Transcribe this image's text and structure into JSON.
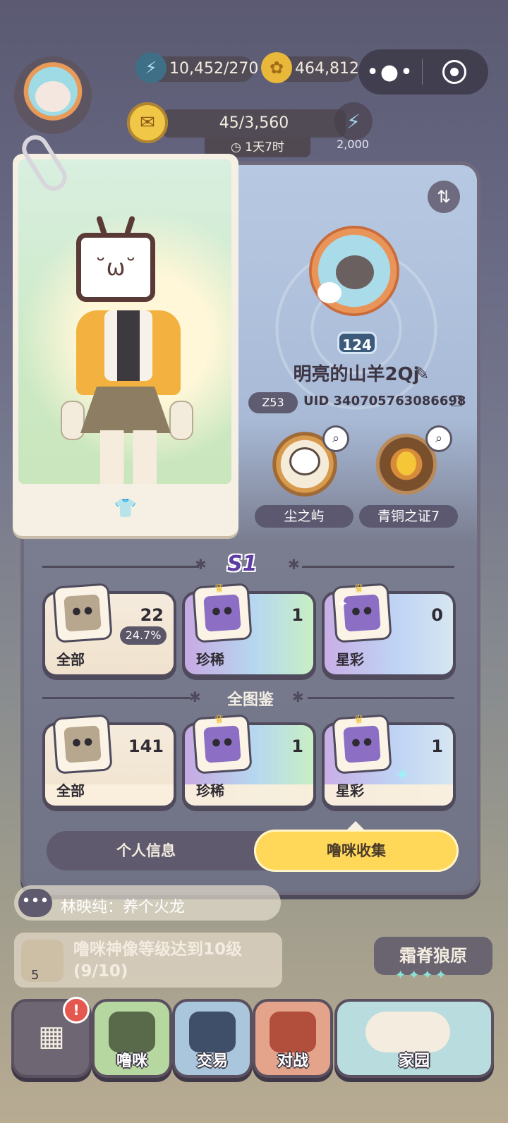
{
  "hud": {
    "energy": "10,452/270",
    "coins": "464,812",
    "task_progress": "45/3,560",
    "task_timer": "1天7时",
    "energy_reward": "2,000",
    "icons": {
      "energy": "lightning-icon",
      "coin": "coin-icon",
      "task": "scroll-icon",
      "timer": "clock-icon"
    }
  },
  "menu": {
    "more_icon": "more-dots-icon",
    "close_icon": "target-icon"
  },
  "profile": {
    "level": "124",
    "username": "明亮的山羊2Qj",
    "rank": "Z53",
    "uid": "UID 340705763086698",
    "badges": [
      {
        "label": "尘之屿"
      },
      {
        "label": "青铜之证7"
      }
    ]
  },
  "collection": {
    "season_logo": "S1",
    "season": [
      {
        "label": "全部",
        "count": "22",
        "percent": "24.7%"
      },
      {
        "label": "珍稀",
        "count": "1"
      },
      {
        "label": "星彩",
        "count": "0"
      }
    ],
    "atlas_title": "全图鉴",
    "atlas": [
      {
        "label": "全部",
        "count": "141"
      },
      {
        "label": "珍稀",
        "count": "1"
      },
      {
        "label": "星彩",
        "count": "1"
      }
    ]
  },
  "tabs": {
    "info": "个人信息",
    "collect": "噜咪收集",
    "active": "collect"
  },
  "chat": {
    "text": "林映纯：养个火龙"
  },
  "quest": {
    "text": "噜咪神像等级达到10级",
    "progress": "(9/10)",
    "level": "5"
  },
  "region": {
    "name": "霜脊狼原",
    "stars": "✦✦✦✦"
  },
  "nav": [
    {
      "label": ""
    },
    {
      "label": "噜咪"
    },
    {
      "label": "交易"
    },
    {
      "label": "对战"
    },
    {
      "label": "家园"
    }
  ],
  "colors": {
    "accent_yellow": "#ffd85a",
    "panel_dark": "#5f5a6d",
    "alert_red": "#e5584f"
  }
}
